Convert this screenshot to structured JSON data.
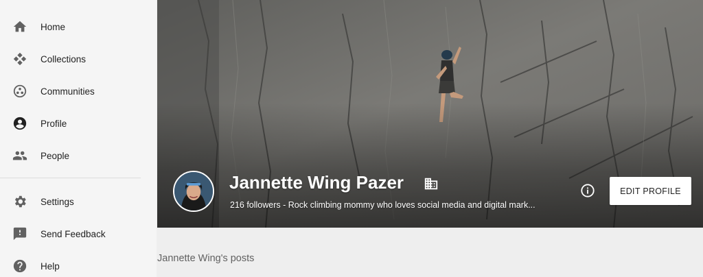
{
  "sidebar": {
    "items": [
      {
        "label": "Home",
        "icon": "home-icon"
      },
      {
        "label": "Collections",
        "icon": "collections-icon"
      },
      {
        "label": "Communities",
        "icon": "communities-icon"
      },
      {
        "label": "Profile",
        "icon": "profile-icon",
        "active": true
      },
      {
        "label": "People",
        "icon": "people-icon"
      }
    ],
    "secondary_items": [
      {
        "label": "Settings",
        "icon": "settings-icon"
      },
      {
        "label": "Send Feedback",
        "icon": "feedback-icon"
      },
      {
        "label": "Help",
        "icon": "help-icon"
      }
    ]
  },
  "profile": {
    "name": "Jannette Wing Pazer",
    "tagline": "216 followers - Rock climbing mommy who loves social media and digital mark...",
    "verified_icon": "building-icon",
    "edit_button_label": "EDIT PROFILE",
    "info_icon": "info-icon"
  },
  "posts": {
    "heading": "Jannette Wing's posts"
  },
  "colors": {
    "page_background": "#eeeeee",
    "sidebar_background": "#f5f5f5",
    "icon_gray": "#616161",
    "button_background": "#ffffff"
  }
}
